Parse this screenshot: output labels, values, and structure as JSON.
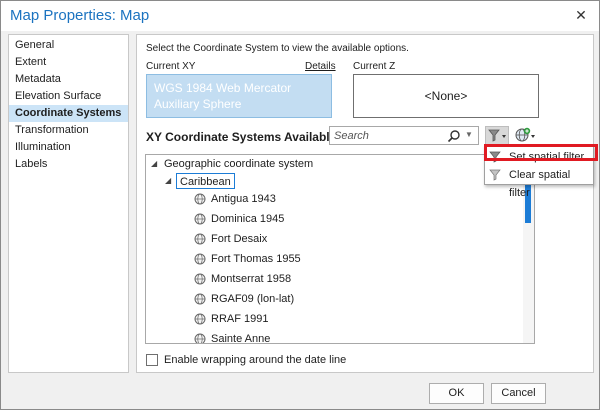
{
  "window": {
    "title": "Map Properties: Map",
    "close_glyph": "✕"
  },
  "nav": {
    "items": [
      {
        "label": "General",
        "selected": false
      },
      {
        "label": "Extent",
        "selected": false
      },
      {
        "label": "Metadata",
        "selected": false
      },
      {
        "label": "Elevation Surface",
        "selected": false
      },
      {
        "label": "Coordinate Systems",
        "selected": true
      },
      {
        "label": "Transformation",
        "selected": false
      },
      {
        "label": "Illumination",
        "selected": false
      },
      {
        "label": "Labels",
        "selected": false
      }
    ]
  },
  "main": {
    "instruction": "Select the Coordinate System to view the available options.",
    "current_xy_label": "Current XY",
    "details_link": "Details",
    "current_z_label": "Current Z",
    "current_xy_value": "WGS 1984 Web Mercator Auxiliary Sphere",
    "current_z_value": "<None>",
    "available_heading": "XY Coordinate Systems Available",
    "search_placeholder": "Search",
    "tree": {
      "root": "Geographic coordinate system",
      "group": "Caribbean",
      "items": [
        "Antigua 1943",
        "Dominica 1945",
        "Fort Desaix",
        "Fort Thomas 1955",
        "Montserrat 1958",
        "RGAF09 (lon-lat)",
        "RRAF 1991",
        "Sainte Anne"
      ]
    },
    "wrap_checkbox_label": "Enable wrapping around the date line",
    "wrap_checked": false
  },
  "filter_menu": {
    "set_label": "Set spatial filter...",
    "clear_label": "Clear spatial filter"
  },
  "footer": {
    "ok_label": "OK",
    "cancel_label": "Cancel"
  },
  "colors": {
    "accent": "#1b73c0",
    "selected_bg": "#cce4f7",
    "highlight": "#e01a22"
  }
}
